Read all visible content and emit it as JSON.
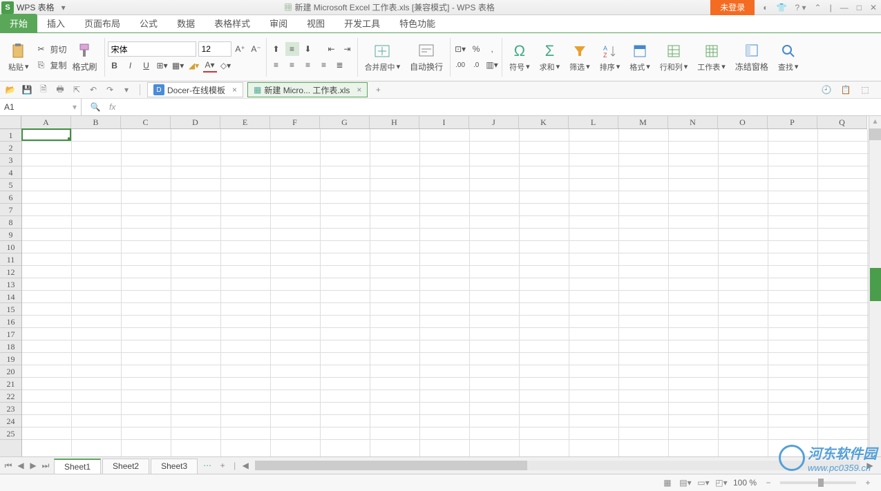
{
  "app": {
    "badge": "S",
    "name": "WPS 表格",
    "title": "新建 Microsoft Excel 工作表.xls [兼容模式] - WPS 表格",
    "login": "未登录"
  },
  "menu": {
    "items": [
      "开始",
      "插入",
      "页面布局",
      "公式",
      "数据",
      "表格样式",
      "审阅",
      "视图",
      "开发工具",
      "特色功能"
    ],
    "active": 0
  },
  "ribbon": {
    "paste": "粘贴",
    "cut": "剪切",
    "copy": "复制",
    "fmtpainter": "格式刷",
    "font": "宋体",
    "size": "12",
    "merge": "合并居中",
    "wrap": "自动换行",
    "symbol": "符号",
    "sum": "求和",
    "filter": "筛选",
    "sort": "排序",
    "format": "格式",
    "rowcol": "行和列",
    "sheet": "工作表",
    "freeze": "冻结窗格",
    "find": "查找"
  },
  "tabs": {
    "docer": "Docer-在线模板",
    "file": "新建 Micro... 工作表.xls"
  },
  "formula": {
    "cell": "A1"
  },
  "columns": [
    "A",
    "B",
    "C",
    "D",
    "E",
    "F",
    "G",
    "H",
    "I",
    "J",
    "K",
    "L",
    "M",
    "N",
    "O",
    "P",
    "Q"
  ],
  "rows": 25,
  "sheets": {
    "items": [
      "Sheet1",
      "Sheet2",
      "Sheet3"
    ],
    "active": 0
  },
  "status": {
    "zoom": "100 %"
  },
  "watermark": {
    "text": "河东软件园",
    "url": "www.pc0359.cn"
  }
}
